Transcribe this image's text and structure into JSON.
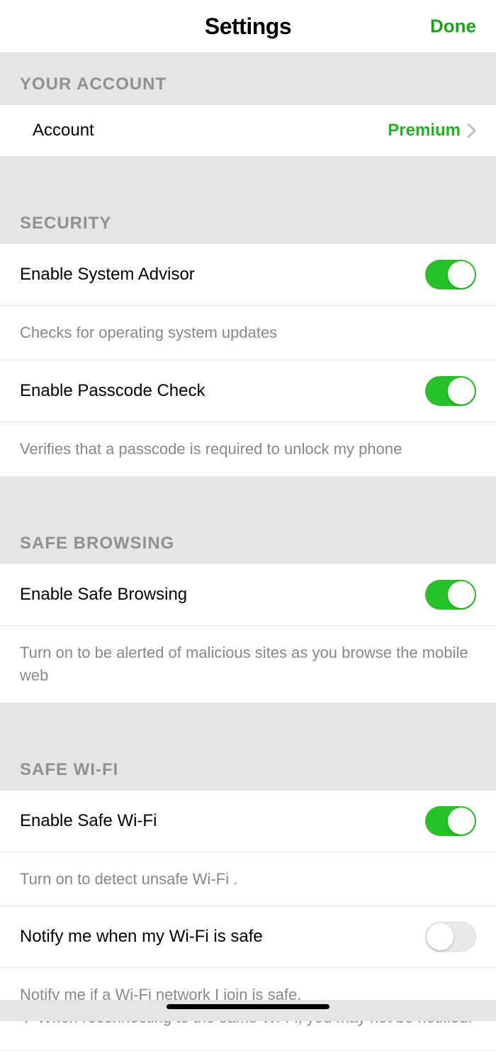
{
  "header": {
    "title": "Settings",
    "done_label": "Done"
  },
  "sections": {
    "account": {
      "title": "YOUR ACCOUNT",
      "account_label": "Account",
      "account_value": "Premium"
    },
    "security": {
      "title": "SECURITY",
      "system_advisor_label": "Enable System Advisor",
      "system_advisor_on": true,
      "system_advisor_desc": "Checks for operating system updates",
      "passcode_label": "Enable Passcode Check",
      "passcode_on": true,
      "passcode_desc": "Verifies that a passcode is required to unlock my phone"
    },
    "browsing": {
      "title": "SAFE BROWSING",
      "safe_browsing_label": "Enable Safe Browsing",
      "safe_browsing_on": true,
      "safe_browsing_desc": "Turn on to be alerted of malicious sites as you browse the mobile web"
    },
    "wifi": {
      "title": "SAFE WI-FI",
      "safe_wifi_label": "Enable Safe Wi-Fi",
      "safe_wifi_on": true,
      "safe_wifi_desc": "Turn on to detect unsafe Wi-Fi .",
      "notify_label": "Notify me when my Wi-Fi is safe",
      "notify_on": false,
      "notify_desc": "Notify me if a Wi-Fi network I join is safe.\n※ When reconnecting to the same Wi-Fi, you may not be notified."
    }
  }
}
